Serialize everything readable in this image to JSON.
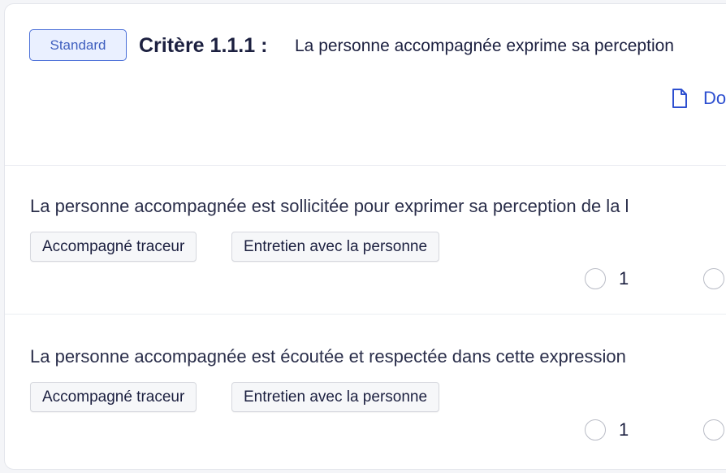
{
  "criterion": {
    "badge_label": "Standard",
    "title": "Critère 1.1.1 :",
    "description": "La personne accompagnée exprime sa perception",
    "doc_link_label": "Do"
  },
  "questions": [
    {
      "text": "La personne accompagnée est sollicitée pour exprimer sa perception de la l",
      "tags": [
        "Accompagné traceur",
        "Entretien avec la personne"
      ],
      "options": [
        "1",
        ""
      ]
    },
    {
      "text": "La personne accompagnée est écoutée et respectée dans cette expression",
      "tags": [
        "Accompagné traceur",
        "Entretien avec la personne"
      ],
      "options": [
        "1",
        ""
      ]
    }
  ],
  "colors": {
    "accent": "#2d4fd0",
    "badge_bg": "#eaf0ff",
    "text": "#1c2040"
  }
}
